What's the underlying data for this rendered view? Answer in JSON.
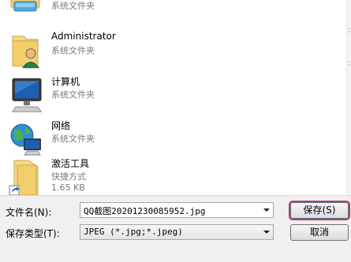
{
  "items": [
    {
      "name": "",
      "type": "系统文件夹",
      "size": "",
      "icon": "folder-partial-icon"
    },
    {
      "name": "Administrator",
      "type": "系统文件夹",
      "size": "",
      "icon": "user-folder-icon"
    },
    {
      "name": "计算机",
      "type": "系统文件夹",
      "size": "",
      "icon": "computer-icon"
    },
    {
      "name": "网络",
      "type": "系统文件夹",
      "size": "",
      "icon": "network-globe-icon"
    },
    {
      "name": "激活工具",
      "type": "快捷方式",
      "size": "1.65 KB",
      "icon": "shortcut-folder-icon"
    }
  ],
  "filename": {
    "label": "文件名(N):",
    "value": "QQ截图20201230085952.jpg"
  },
  "filetype": {
    "label": "保存类型(T):",
    "value": "JPEG (*.jpg;*.jpeg)"
  },
  "buttons": {
    "save": "保存(S)",
    "cancel": "取消"
  },
  "colors": {
    "highlight_border": "#e03030",
    "folder": "#f3cf6b",
    "monitor_screen": "#1a5fb4"
  }
}
